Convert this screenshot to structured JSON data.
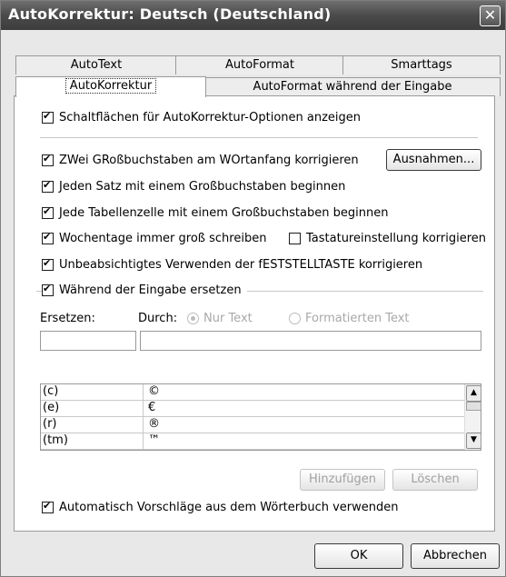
{
  "window": {
    "title": "AutoKorrektur: Deutsch (Deutschland)",
    "close_glyph": "✕"
  },
  "tabs": {
    "row1": [
      "AutoText",
      "AutoFormat",
      "Smarttags"
    ],
    "row2": [
      "AutoKorrektur",
      "AutoFormat während der Eingabe"
    ]
  },
  "options": {
    "show_buttons": {
      "label": "Schaltflächen für AutoKorrektur-Optionen anzeigen",
      "checked": true
    },
    "two_caps": {
      "label": "ZWei GRoßbuchstaben am WOrtanfang korrigieren",
      "checked": true
    },
    "sentence_cap": {
      "label": "Jeden Satz mit einem Großbuchstaben beginnen",
      "checked": true
    },
    "table_cell_cap": {
      "label": "Jede Tabellenzelle mit einem Großbuchstaben beginnen",
      "checked": true
    },
    "weekdays_cap": {
      "label": "Wochentage immer groß schreiben",
      "checked": true
    },
    "keyboard_fix": {
      "label": "Tastatureinstellung korrigieren",
      "checked": false
    },
    "capslock_fix": {
      "label": "Unbeabsichtigtes Verwenden der fESTSTELLTASTE korrigieren",
      "checked": true
    },
    "replace_while_typing": {
      "label": "Während der Eingabe ersetzen",
      "checked": true
    },
    "auto_suggest": {
      "label": "Automatisch Vorschläge aus dem Wörterbuch verwenden",
      "checked": true
    }
  },
  "exceptions_button": "Ausnahmen...",
  "replace": {
    "replace_label": "Ersetzen:",
    "with_label": "Durch:",
    "radio_plain": {
      "label": "Nur Text",
      "selected": true
    },
    "radio_formatted": {
      "label": "Formatierten Text",
      "selected": false
    },
    "replace_value": "",
    "with_value": ""
  },
  "entries": [
    {
      "from": "(c)",
      "to": "©"
    },
    {
      "from": "(e)",
      "to": "€"
    },
    {
      "from": "(r)",
      "to": "®"
    },
    {
      "from": "(tm)",
      "to": "™"
    }
  ],
  "buttons": {
    "add": "Hinzufügen",
    "delete": "Löschen",
    "ok": "OK",
    "cancel": "Abbrechen"
  },
  "icons": {
    "scroll_up": "scroll-up-arrow-icon",
    "scroll_down": "scroll-down-arrow-icon"
  }
}
